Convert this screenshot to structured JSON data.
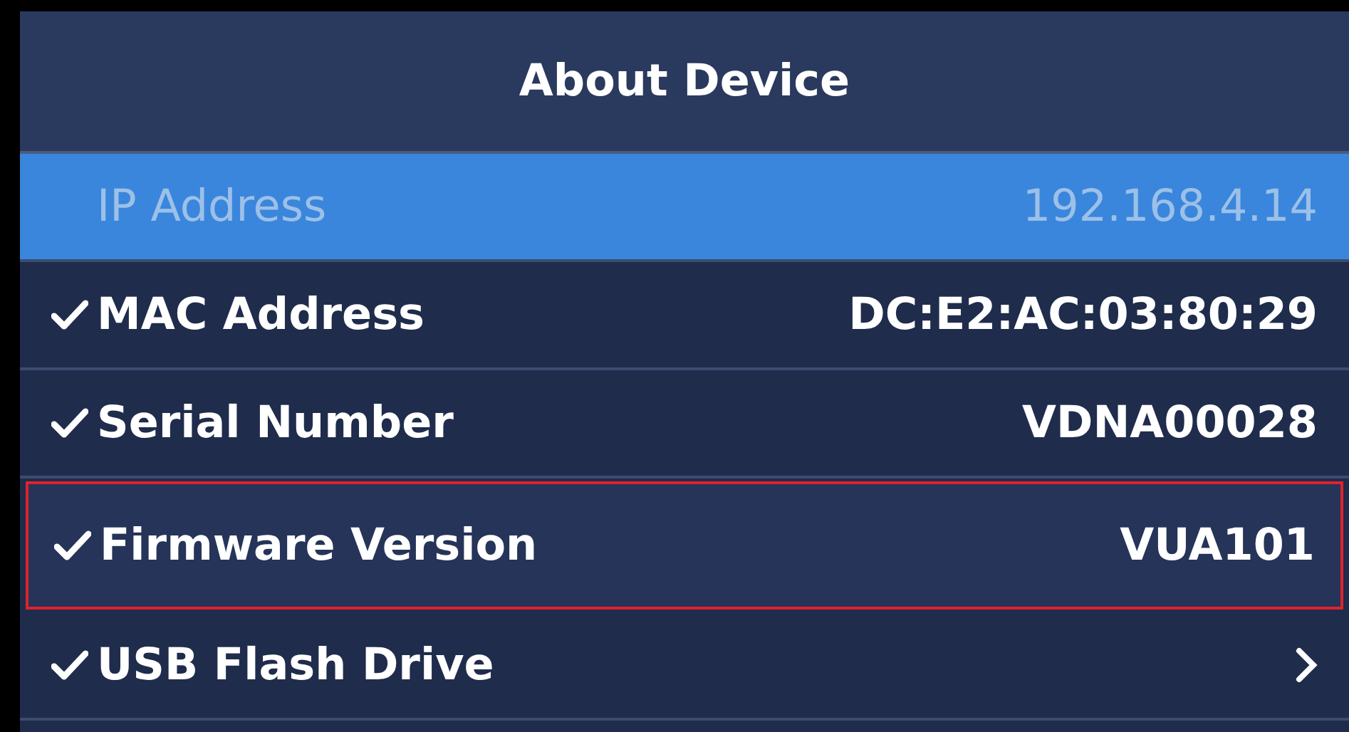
{
  "header": {
    "title": "About Device"
  },
  "rows": [
    {
      "kind": "info",
      "label": "IP Address",
      "value": "192.168.4.14",
      "selected": true,
      "checked": false,
      "highlighted": false
    },
    {
      "kind": "info",
      "label": "MAC Address",
      "value": "DC:E2:AC:03:80:29",
      "selected": false,
      "checked": true,
      "highlighted": false
    },
    {
      "kind": "info",
      "label": "Serial Number",
      "value": "VDNA00028",
      "selected": false,
      "checked": true,
      "highlighted": false
    },
    {
      "kind": "info",
      "label": "Firmware Version",
      "value": "VUA101",
      "selected": false,
      "checked": true,
      "highlighted": true
    },
    {
      "kind": "link",
      "label": "USB Flash Drive",
      "selected": false,
      "checked": true,
      "highlighted": false
    }
  ]
}
